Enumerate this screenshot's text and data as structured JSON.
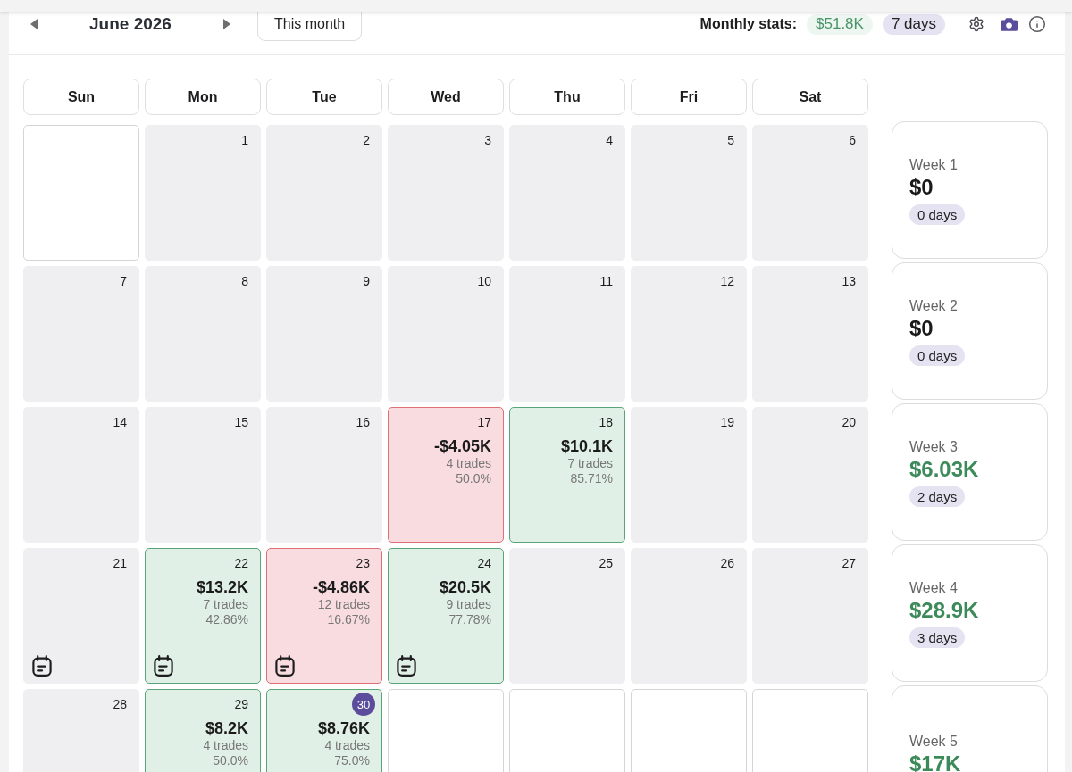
{
  "header": {
    "month": "June 2026",
    "today_button": "This month",
    "stats_label": "Monthly stats:",
    "stats_pnl": "$51.8K",
    "stats_days": "7 days"
  },
  "weekdays": [
    "Sun",
    "Mon",
    "Tue",
    "Wed",
    "Thu",
    "Fri",
    "Sat"
  ],
  "weeks": [
    {
      "days": [
        {
          "kind": "blank"
        },
        {
          "kind": "empty",
          "date": "1",
          "today": false,
          "note": false
        },
        {
          "kind": "empty",
          "date": "2",
          "today": false,
          "note": false
        },
        {
          "kind": "empty",
          "date": "3",
          "today": false,
          "note": false
        },
        {
          "kind": "empty",
          "date": "4",
          "today": false,
          "note": false
        },
        {
          "kind": "empty",
          "date": "5",
          "today": false,
          "note": false
        },
        {
          "kind": "empty",
          "date": "6",
          "today": false,
          "note": false
        }
      ],
      "summary": {
        "label": "Week 1",
        "pnl": "$0",
        "kind": "flat",
        "days": "0 days"
      }
    },
    {
      "days": [
        {
          "kind": "empty",
          "date": "7",
          "today": false,
          "note": false
        },
        {
          "kind": "empty",
          "date": "8",
          "today": false,
          "note": false
        },
        {
          "kind": "empty",
          "date": "9",
          "today": false,
          "note": false
        },
        {
          "kind": "empty",
          "date": "10",
          "today": false,
          "note": false
        },
        {
          "kind": "empty",
          "date": "11",
          "today": false,
          "note": false
        },
        {
          "kind": "empty",
          "date": "12",
          "today": false,
          "note": false
        },
        {
          "kind": "empty",
          "date": "13",
          "today": false,
          "note": false
        }
      ],
      "summary": {
        "label": "Week 2",
        "pnl": "$0",
        "kind": "flat",
        "days": "0 days"
      }
    },
    {
      "days": [
        {
          "kind": "empty",
          "date": "14",
          "today": false,
          "note": false
        },
        {
          "kind": "empty",
          "date": "15",
          "today": false,
          "note": false
        },
        {
          "kind": "empty",
          "date": "16",
          "today": false,
          "note": false
        },
        {
          "kind": "loss",
          "date": "17",
          "pnl": "-$4.05K",
          "trades": "4 trades",
          "win_rate": "50.0%",
          "today": false,
          "note": false
        },
        {
          "kind": "profit",
          "date": "18",
          "pnl": "$10.1K",
          "trades": "7 trades",
          "win_rate": "85.71%",
          "today": false,
          "note": false
        },
        {
          "kind": "empty",
          "date": "19",
          "today": false,
          "note": false
        },
        {
          "kind": "empty",
          "date": "20",
          "today": false,
          "note": false
        }
      ],
      "summary": {
        "label": "Week 3",
        "pnl": "$6.03K",
        "kind": "gain",
        "days": "2 days"
      }
    },
    {
      "days": [
        {
          "kind": "empty",
          "date": "21",
          "today": false,
          "note": true
        },
        {
          "kind": "profit",
          "date": "22",
          "pnl": "$13.2K",
          "trades": "7 trades",
          "win_rate": "42.86%",
          "today": false,
          "note": true
        },
        {
          "kind": "loss",
          "date": "23",
          "pnl": "-$4.86K",
          "trades": "12 trades",
          "win_rate": "16.67%",
          "today": false,
          "note": true
        },
        {
          "kind": "profit",
          "date": "24",
          "pnl": "$20.5K",
          "trades": "9 trades",
          "win_rate": "77.78%",
          "today": false,
          "note": true
        },
        {
          "kind": "empty",
          "date": "25",
          "today": false,
          "note": false
        },
        {
          "kind": "empty",
          "date": "26",
          "today": false,
          "note": false
        },
        {
          "kind": "empty",
          "date": "27",
          "today": false,
          "note": false
        }
      ],
      "summary": {
        "label": "Week 4",
        "pnl": "$28.9K",
        "kind": "gain",
        "days": "3 days"
      }
    },
    {
      "days": [
        {
          "kind": "empty",
          "date": "28",
          "today": false,
          "note": false
        },
        {
          "kind": "profit",
          "date": "29",
          "pnl": "$8.2K",
          "trades": "4 trades",
          "win_rate": "50.0%",
          "today": false,
          "note": false
        },
        {
          "kind": "profit",
          "date": "30",
          "pnl": "$8.76K",
          "trades": "4 trades",
          "win_rate": "75.0%",
          "today": true,
          "note": false
        },
        {
          "kind": "blank"
        },
        {
          "kind": "blank"
        },
        {
          "kind": "blank"
        },
        {
          "kind": "blank"
        }
      ],
      "summary": {
        "label": "Week 5",
        "pnl": "$17K",
        "kind": "gain"
      }
    }
  ]
}
